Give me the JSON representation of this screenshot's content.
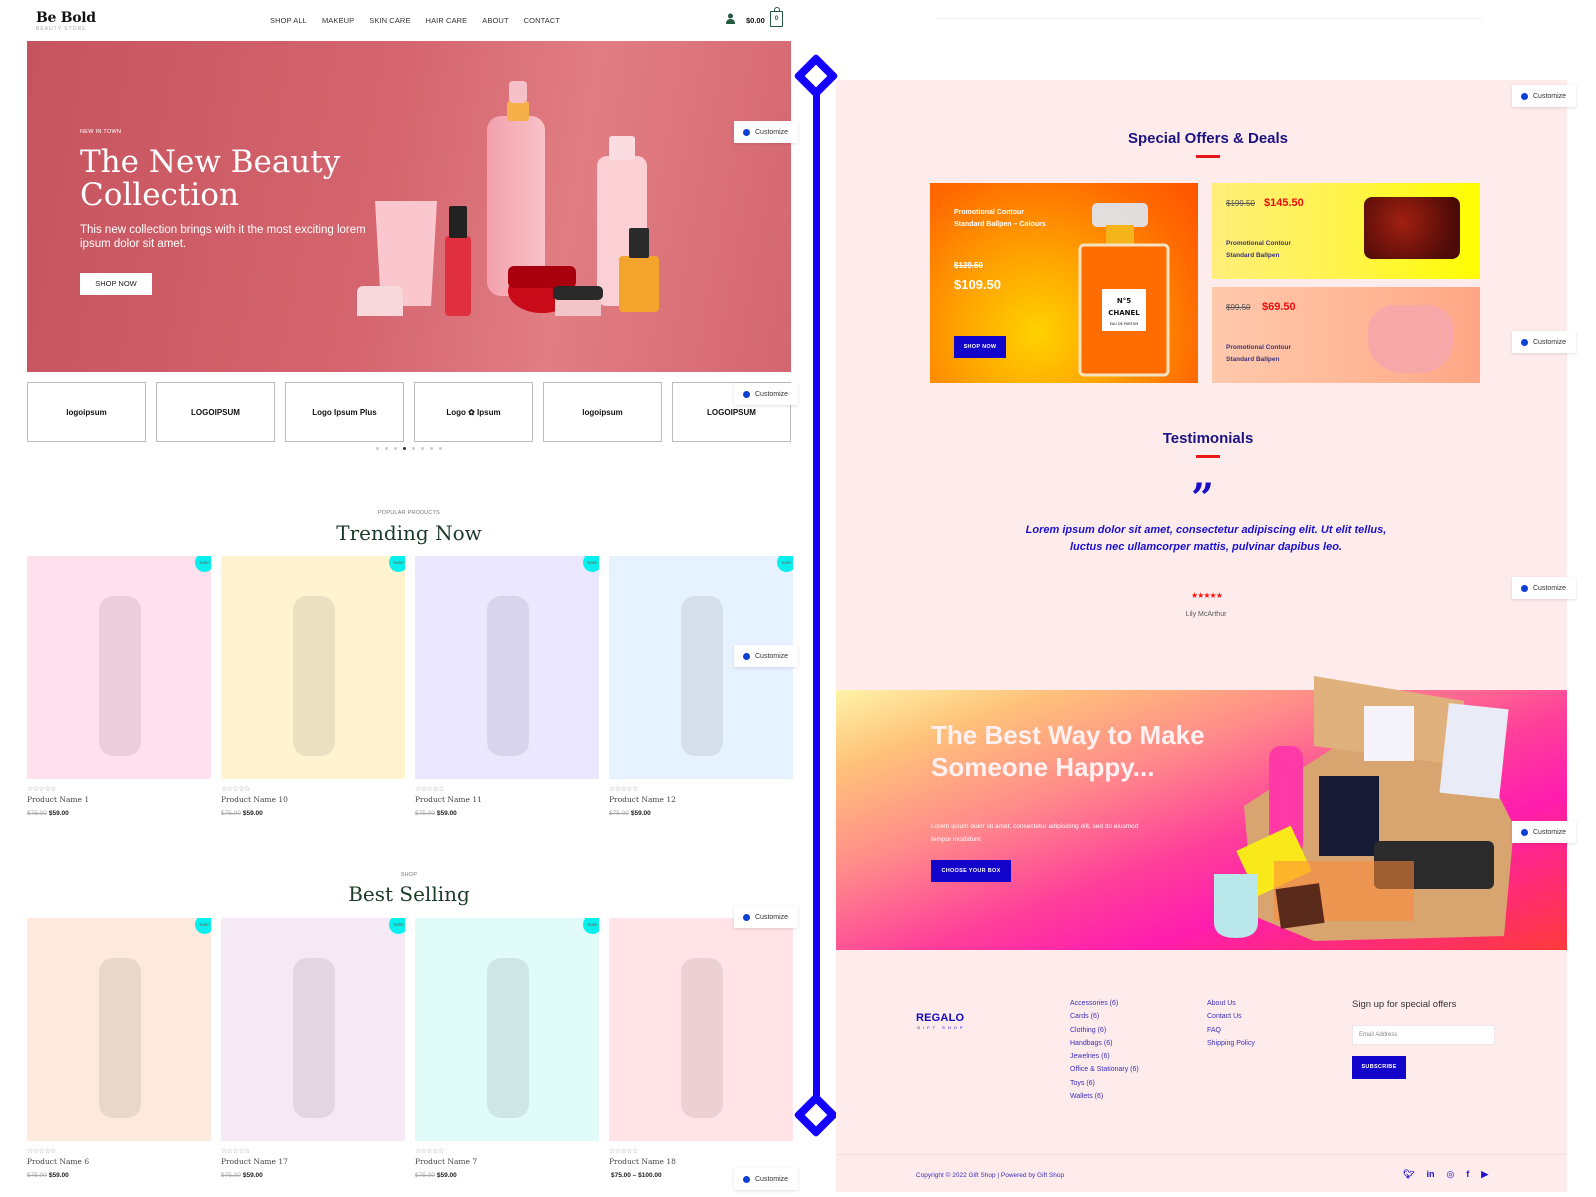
{
  "left_site": {
    "brand": {
      "name": "Be Bold",
      "tagline": "BEAUTY STORE"
    },
    "nav": [
      "SHOP ALL",
      "MAKEUP",
      "SKIN CARE",
      "HAIR CARE",
      "ABOUT",
      "CONTACT"
    ],
    "cart": {
      "total": "$0.00",
      "count": "0"
    },
    "hero": {
      "kicker": "NEW IN TOWN",
      "title": "The New Beauty Collection",
      "description": "This new collection brings with it the most exciting lorem ipsum dolor sit amet.",
      "button": "SHOP NOW"
    },
    "customize_label": "Customize",
    "brand_logos": [
      "logoipsum",
      "LOGOIPSUM",
      "Logo Ipsum Plus",
      "Logo ✿ Ipsum",
      "logoipsum",
      "LOGOIPSUM"
    ],
    "carousel": {
      "dots": 8,
      "active": 4
    },
    "trending": {
      "kicker": "POPULAR PRODUCTS",
      "title": "Trending Now",
      "products": [
        {
          "name": "Product Name 1",
          "old_price": "$75.00",
          "price": "$59.00",
          "badge": "Sale!",
          "bg": "#ffe0ec"
        },
        {
          "name": "Product Name 10",
          "old_price": "$75.00",
          "price": "$59.00",
          "badge": "Sale!",
          "bg": "#fff3d0"
        },
        {
          "name": "Product Name 11",
          "old_price": "$75.00",
          "price": "$59.00",
          "badge": "Sale!",
          "bg": "#ebe7ff"
        },
        {
          "name": "Product Name 12",
          "old_price": "$75.00",
          "price": "$59.00",
          "badge": "Sale!",
          "bg": "#e6f2ff"
        }
      ]
    },
    "best_selling": {
      "kicker": "SHOP",
      "title": "Best Selling",
      "products": [
        {
          "name": "Product Name 6",
          "old_price": "$75.00",
          "price": "$59.00",
          "badge": "Sale!",
          "bg": "#fdeadd"
        },
        {
          "name": "Product Name 17",
          "old_price": "$75.00",
          "price": "$59.00",
          "badge": "Sale!",
          "bg": "#f6e9f6"
        },
        {
          "name": "Product Name 7",
          "old_price": "$75.00",
          "price": "$59.00",
          "badge": "Sale!",
          "bg": "#e0fbf8"
        },
        {
          "name": "Product Name 18",
          "old_price": "",
          "price": "$75.00 – $100.00",
          "badge": "",
          "bg": "#ffe3e6"
        }
      ]
    },
    "rating_stars": "☆☆☆☆☆"
  },
  "right_site": {
    "offers": {
      "title": "Special Offers & Deals",
      "big": {
        "text": "Promotional Contour Standard Ballpen – Colours",
        "old_price": "$139.50",
        "price": "$109.50",
        "button": "SHOP NOW",
        "label": "N°5 CHANEL",
        "sublabel": "EAU DE PARFUM"
      },
      "small": [
        {
          "old_price": "$199.50",
          "price": "$145.50",
          "text": "Promotional Contour Standard Ballpen"
        },
        {
          "old_price": "$99.50",
          "price": "$69.50",
          "text": "Promotional Contour Standard Ballpen"
        }
      ]
    },
    "testimonials": {
      "title": "Testimonials",
      "quote": "Lorem ipsum dolor sit amet, consectetur adipiscing elit. Ut elit tellus, luctus nec ullamcorper mattis, pulvinar dapibus leo.",
      "stars": "★★★★★",
      "rating": 5,
      "author": "Lily McArthur"
    },
    "banner": {
      "title": "The Best Way to Make Someone Happy...",
      "description": "Lorem ipsum dolor sit amet, consectetur adipisicing elit, sed do eiusmod tempor incididunt",
      "button": "CHOOSE YOUR BOX"
    },
    "footer": {
      "logo": "REGALO",
      "logo_sub": "GIFT SHOP",
      "categories": [
        "Accessories (6)",
        "Cards (6)",
        "Clothing (6)",
        "Handbags (6)",
        "Jewelries (6)",
        "Office & Stationary (6)",
        "Toys (6)",
        "Wallets (6)"
      ],
      "links": [
        "About Us",
        "Contact Us",
        "FAQ",
        "Shipping Policy"
      ],
      "signup_title": "Sign up for special offers",
      "email_placeholder": "Email Address",
      "subscribe": "SUBSCRIBE",
      "copyright": "Copyright © 2022 Gift Shop | Powered by Gift Shop",
      "social": [
        "twitter",
        "linkedin",
        "instagram",
        "facebook",
        "youtube"
      ]
    }
  },
  "divider": {
    "color": "#1400ff"
  }
}
